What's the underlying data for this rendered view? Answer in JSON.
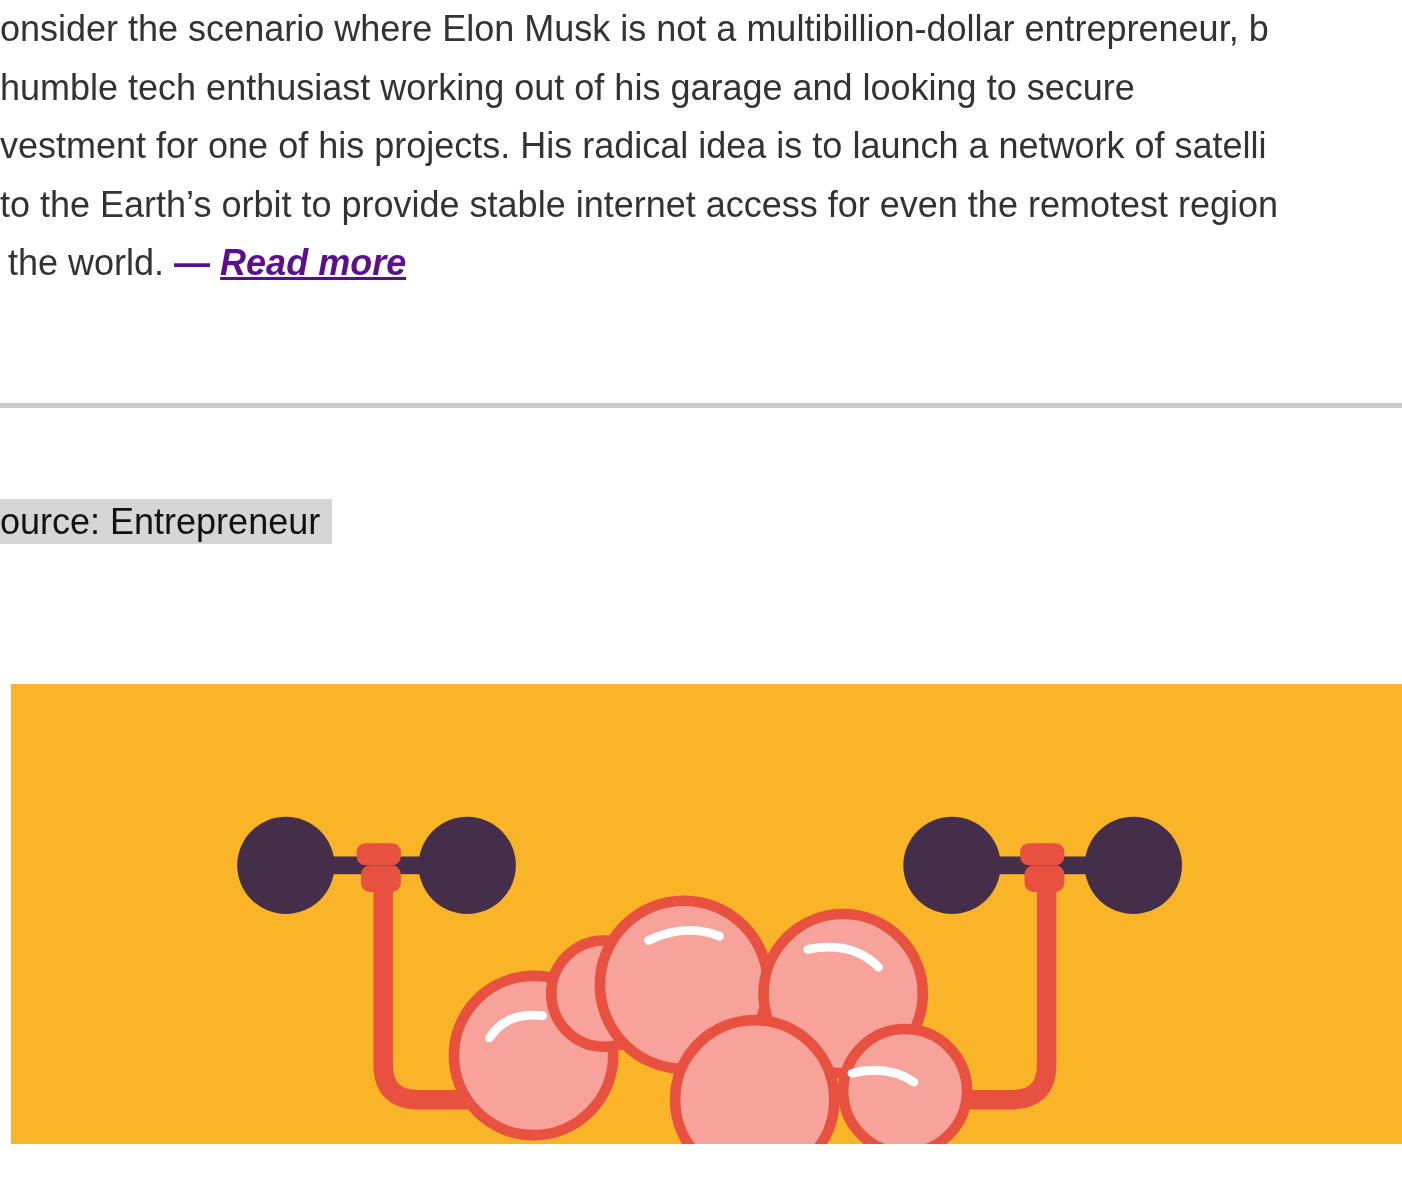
{
  "article": {
    "lines": [
      "onsider the scenario where Elon Musk is not a multibillion-dollar entrepreneur, b",
      "humble tech enthusiast working out of his garage and looking to secure",
      "vestment for one of his projects. His radical idea is to launch a network of satelli",
      "to the Earth’s orbit to provide stable internet access for even the remotest region",
      "the world."
    ],
    "read_more": {
      "dash": "—",
      "link": "Read more"
    }
  },
  "source": "ource: Entrepreneur"
}
